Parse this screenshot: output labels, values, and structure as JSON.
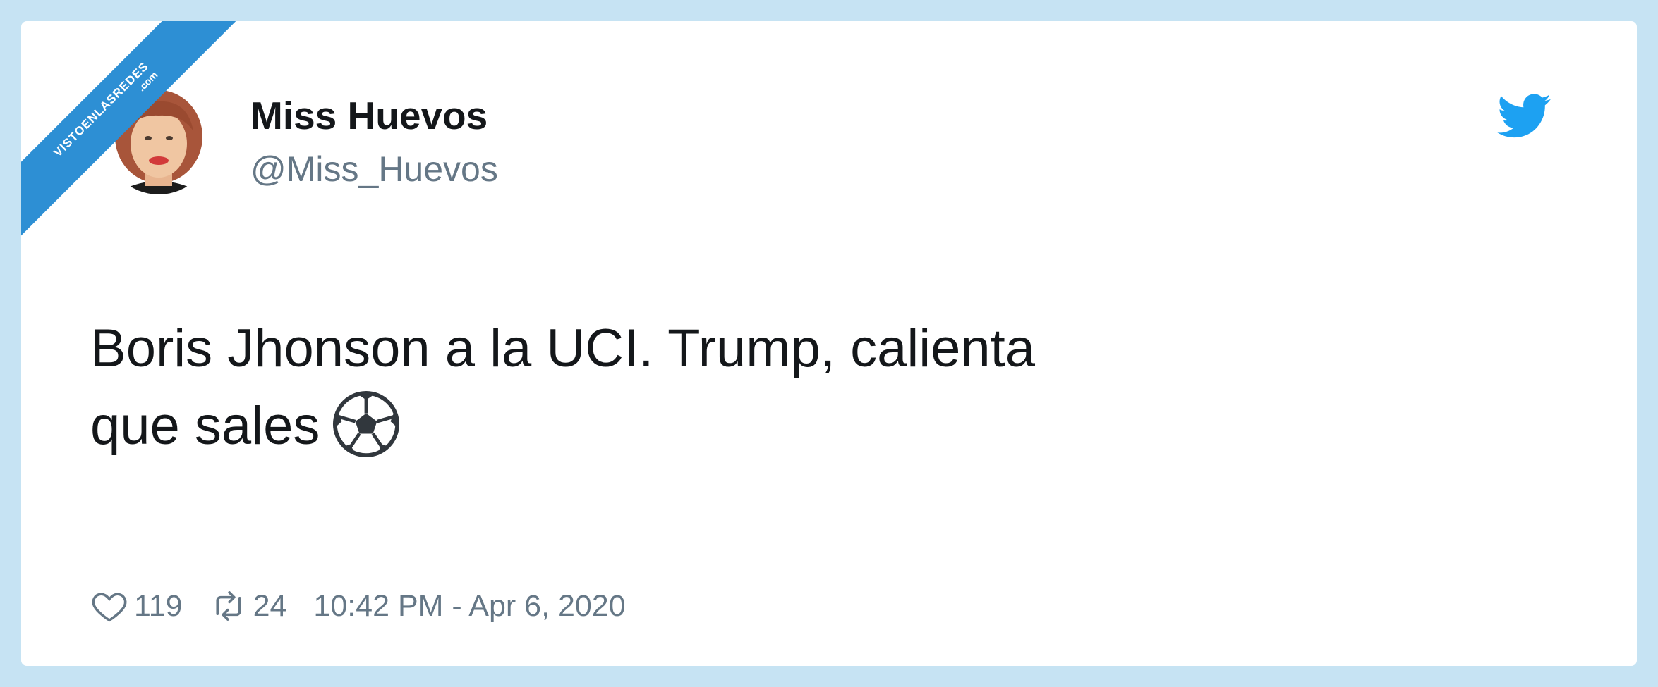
{
  "watermark": {
    "line1": "VISTOENLASREDES",
    "line2": ".com"
  },
  "tweet": {
    "display_name": "Miss Huevos",
    "handle": "@Miss_Huevos",
    "text_line1": "Boris Jhonson a la UCI. Trump, calienta",
    "text_line2": "que sales",
    "emoji": "soccer-ball-icon",
    "likes": "119",
    "retweets": "24",
    "timestamp": "10:42 PM - Apr 6, 2020",
    "brand_icon": "twitter-bird-icon"
  },
  "colors": {
    "background": "#c6e3f3",
    "card": "#ffffff",
    "text_primary": "#14171a",
    "text_secondary": "#657786",
    "twitter_blue": "#1da1f2",
    "ribbon": "#2d8fd4"
  }
}
